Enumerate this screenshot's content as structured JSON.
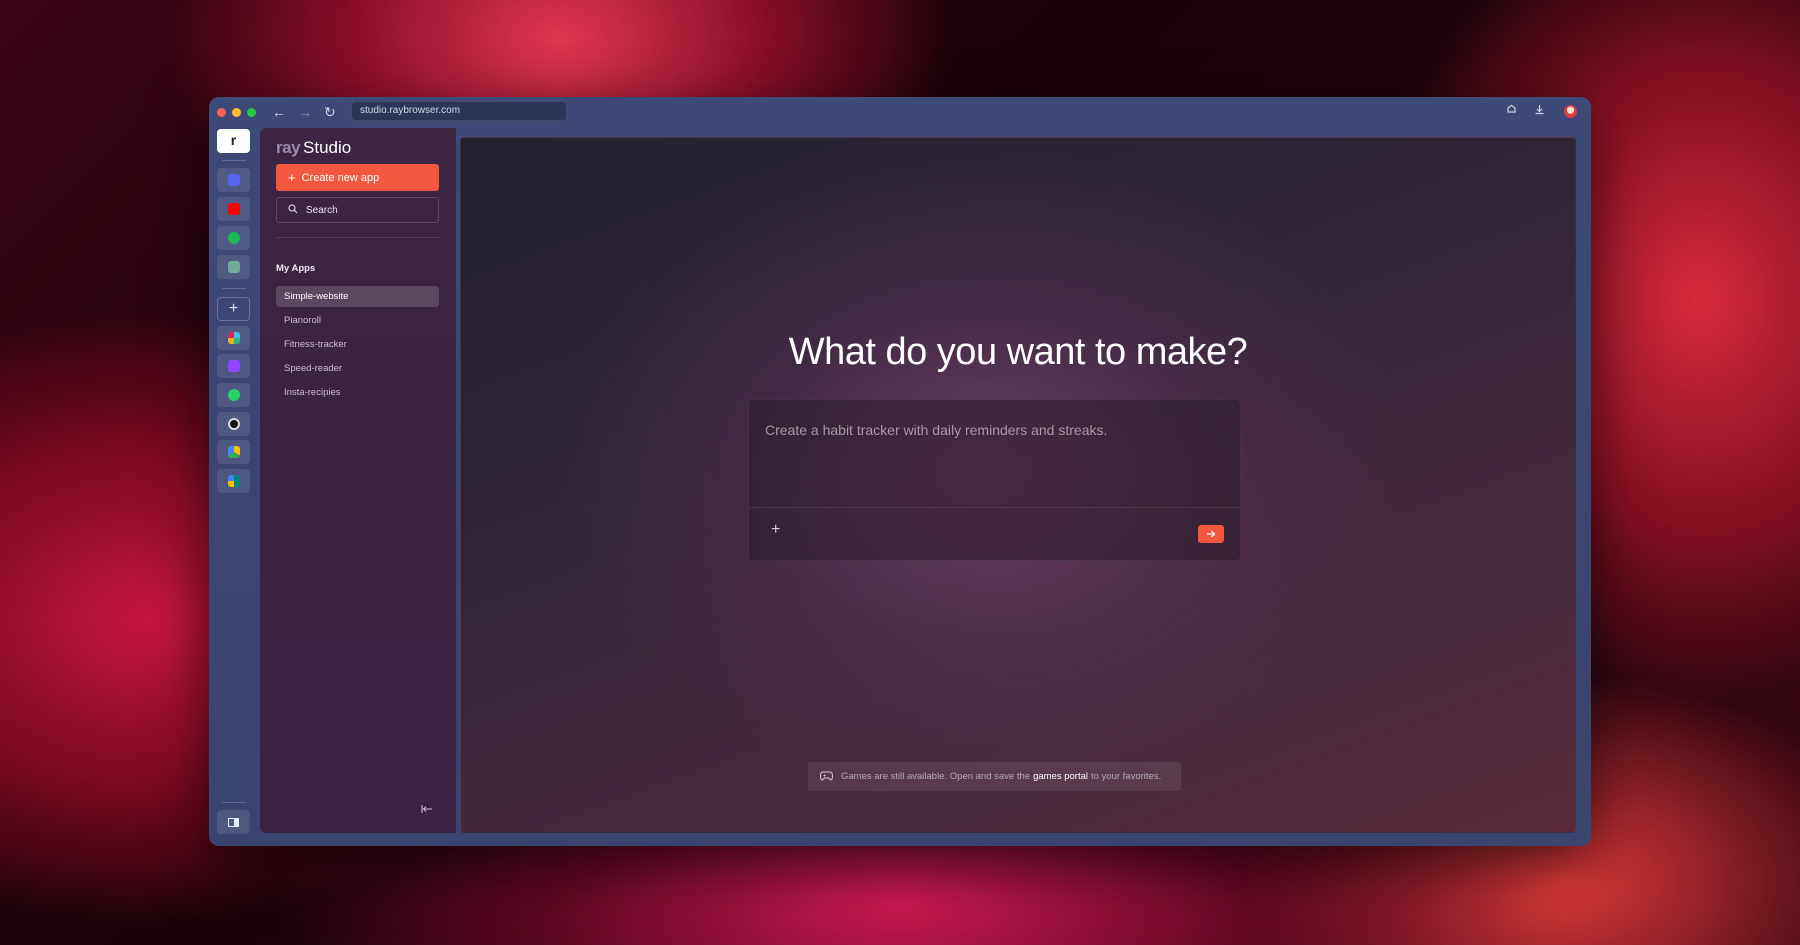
{
  "browser": {
    "url": "studio.raybrowser.com",
    "back_icon": "←",
    "forward_icon": "→",
    "reload_icon": "↻"
  },
  "rail": {
    "top_logo": "r",
    "apps": [
      {
        "name": "discord-icon",
        "color": "#5865F2"
      },
      {
        "name": "youtube-icon",
        "color": "#FF0000"
      },
      {
        "name": "spotify-icon",
        "color": "#1DB954"
      },
      {
        "name": "chatgpt-icon",
        "color": "#74AA9C"
      },
      {
        "name": "slack-icon",
        "color": "#E01E5A"
      },
      {
        "name": "twitch-icon",
        "color": "#9146FF"
      },
      {
        "name": "whatsapp-icon",
        "color": "#25D366"
      },
      {
        "name": "github-icon",
        "color": "#222222"
      },
      {
        "name": "google-drive-icon",
        "color": "#FBBC04"
      },
      {
        "name": "google-meet-icon",
        "color": "#00897B"
      }
    ],
    "add_label": "+"
  },
  "sidebar": {
    "brand_prefix": "ray",
    "brand_name": "Studio",
    "create_button": "Create new app",
    "search_label": "Search",
    "section_title": "My Apps",
    "apps": [
      "Simple-website",
      "Pianoroll",
      "Fitness-tracker",
      "Speed-reader",
      "Insta-recipies"
    ],
    "active_app": "Simple-website"
  },
  "main": {
    "headline": "What do you want to make?",
    "prompt_placeholder": "Create a habit tracker with daily reminders and streaks.",
    "games_notice": {
      "before": "Games are still available. Open and save the",
      "link": "games portal",
      "after": "to your favorites."
    }
  },
  "colors": {
    "accent": "#F2583D"
  }
}
